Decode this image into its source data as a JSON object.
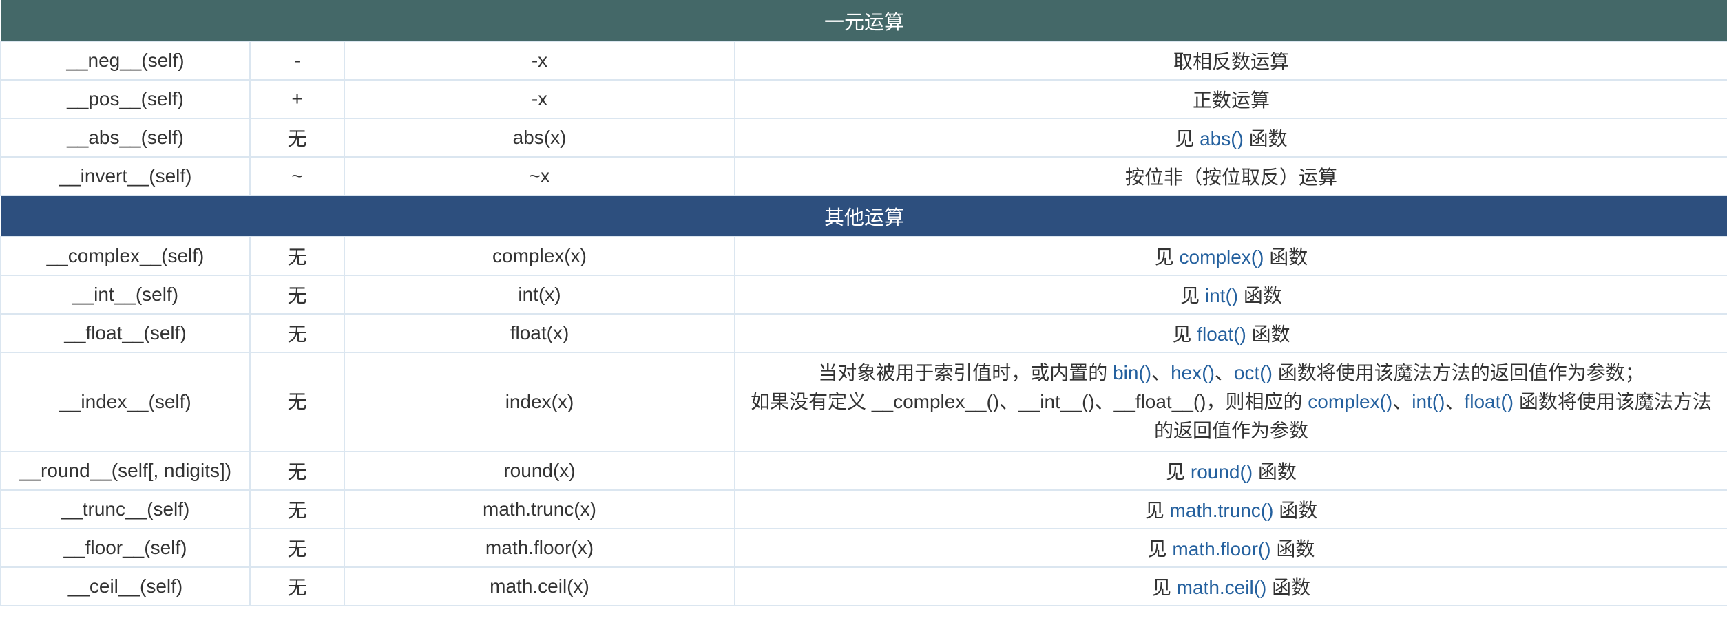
{
  "colors": {
    "section_unary_bg": "#446868",
    "section_other_bg": "#2d4f7e",
    "link": "#24609e",
    "border": "#dbe6f0",
    "text": "#333333"
  },
  "sections": {
    "unary": {
      "title": "一元运算",
      "rows": [
        {
          "method": "__neg__(self)",
          "operator": "-",
          "call": "-x",
          "desc": "取相反数运算"
        },
        {
          "method": "__pos__(self)",
          "operator": "+",
          "call": "-x",
          "desc": "正数运算"
        },
        {
          "method": "__abs__(self)",
          "operator": "无",
          "call": "abs(x)",
          "desc_pre": "见 ",
          "desc_link": "abs()",
          "desc_post": " 函数"
        },
        {
          "method": "__invert__(self)",
          "operator": "~",
          "call": "~x",
          "desc": "按位非（按位取反）运算"
        }
      ]
    },
    "other": {
      "title": "其他运算",
      "rows": [
        {
          "method": "__complex__(self)",
          "operator": "无",
          "call": "complex(x)",
          "desc_pre": "见 ",
          "desc_link": "complex()",
          "desc_post": " 函数"
        },
        {
          "method": "__int__(self)",
          "operator": "无",
          "call": "int(x)",
          "desc_pre": "见 ",
          "desc_link": "int()",
          "desc_post": " 函数"
        },
        {
          "method": "__float__(self)",
          "operator": "无",
          "call": "float(x)",
          "desc_pre": "见 ",
          "desc_link": "float()",
          "desc_post": " 函数"
        },
        {
          "method": "__index__(self)",
          "operator": "无",
          "call": "index(x)",
          "line1_pre": "当对象被用于索引值时，或内置的 ",
          "line1_link_bin": "bin()",
          "sep1": "、",
          "line1_link_hex": "hex()",
          "sep2": "、",
          "line1_link_oct": "oct()",
          "line1_post": " 函数将使用该魔法方法的返回值作为参数；",
          "line2_pre": "如果没有定义 __complex__()、__int__()、__float__()，则相应的 ",
          "line2_link_complex": "complex()",
          "sep3": "、",
          "line2_link_int": "int()",
          "sep4": "、",
          "line2_link_float": "float()",
          "line2_post": " 函数将使用该魔法方法",
          "line3": "的返回值作为参数"
        },
        {
          "method": "__round__(self[, ndigits])",
          "operator": "无",
          "call": "round(x)",
          "desc_pre": "见 ",
          "desc_link": "round()",
          "desc_post": " 函数"
        },
        {
          "method": "__trunc__(self)",
          "operator": "无",
          "call": "math.trunc(x)",
          "desc_pre": "见 ",
          "desc_link": "math.trunc()",
          "desc_post": " 函数"
        },
        {
          "method": "__floor__(self)",
          "operator": "无",
          "call": "math.floor(x)",
          "desc_pre": "见 ",
          "desc_link": "math.floor()",
          "desc_post": " 函数"
        },
        {
          "method": "__ceil__(self)",
          "operator": "无",
          "call": "math.ceil(x)",
          "desc_pre": "见 ",
          "desc_link": "math.ceil()",
          "desc_post": " 函数"
        }
      ]
    }
  }
}
